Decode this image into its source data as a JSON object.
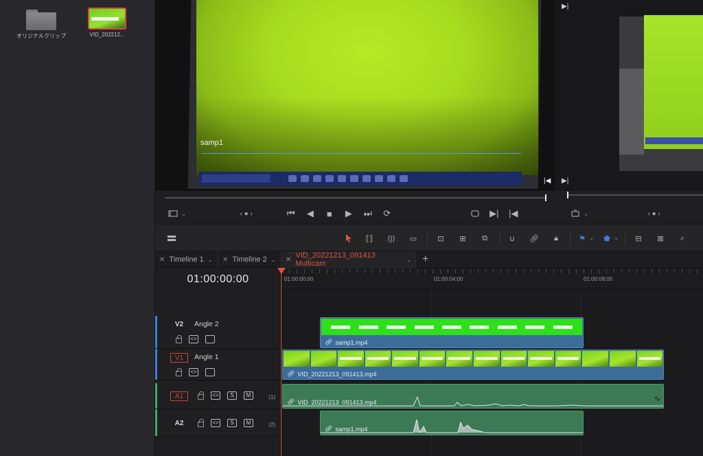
{
  "media_pool": {
    "items": [
      {
        "label": "オリジナルクリップ",
        "type": "folder"
      },
      {
        "label": "VID_202212...",
        "type": "clip"
      }
    ]
  },
  "source_viewer": {
    "overlay_text": "samp1"
  },
  "timeline": {
    "tabs": [
      {
        "label": "Timeline 1",
        "active": false
      },
      {
        "label": "Timeline 2",
        "active": false
      },
      {
        "label": "VID_20221213_091413 Multicam",
        "active": true
      }
    ],
    "add_tab_label": "+",
    "timecode": "01:00:00:00",
    "ruler_labels": [
      "01:00:00:00",
      "01:00:04:00",
      "01:00:08:00"
    ],
    "tracks": [
      {
        "id": "V2",
        "name": "Angle 2",
        "kind": "video"
      },
      {
        "id": "V1",
        "name": "Angle 1",
        "kind": "video"
      },
      {
        "id": "A1",
        "name": "",
        "kind": "audio",
        "channel": "(1)"
      },
      {
        "id": "A2",
        "name": "",
        "kind": "audio",
        "channel": "(2)"
      }
    ],
    "clips": {
      "v2": "samp1.mp4",
      "v1": "VID_20221213_091413.mp4",
      "a1": "VID_20221213_091413.mp4",
      "a2": "samp1.mp4"
    },
    "solo_label": "S",
    "mute_label": "M"
  },
  "colors": {
    "accent": "#e4503f",
    "video_clip": "#3b6d99",
    "audio_clip": "#3c7a56"
  }
}
